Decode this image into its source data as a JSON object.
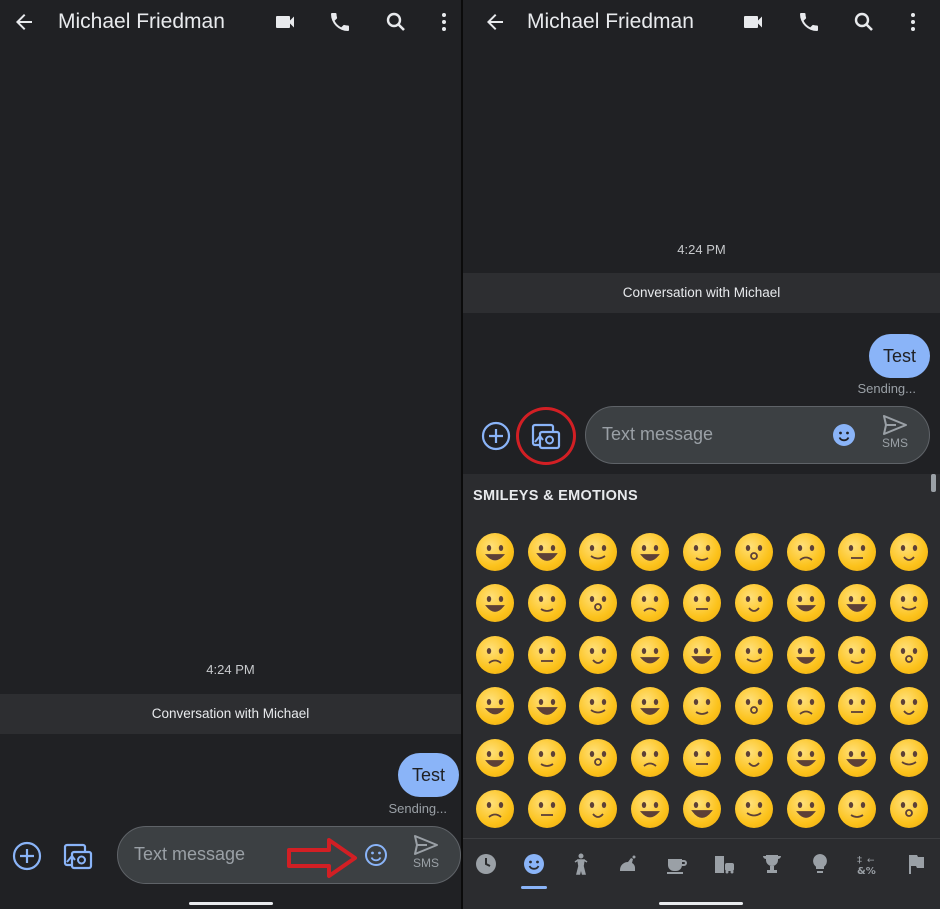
{
  "app": {
    "contact_name": "Michael Friedman"
  },
  "chat": {
    "timestamp": "4:24 PM",
    "conversation_banner": "Conversation with Michael",
    "messages": [
      {
        "text": "Test",
        "status": "Sending..."
      }
    ]
  },
  "compose": {
    "placeholder": "Text message",
    "send_label": "SMS"
  },
  "emoji_panel": {
    "header": "SMILEYS & EMOTIONS",
    "categories": [
      "recent",
      "smileys",
      "people",
      "animals",
      "food",
      "travel",
      "activities",
      "objects",
      "symbols",
      "flags"
    ],
    "active_category": "smileys"
  },
  "colors": {
    "background": "#202124",
    "bubble": "#8ab4f8",
    "accent": "#8ab4f8",
    "annotation": "#d21f24"
  }
}
